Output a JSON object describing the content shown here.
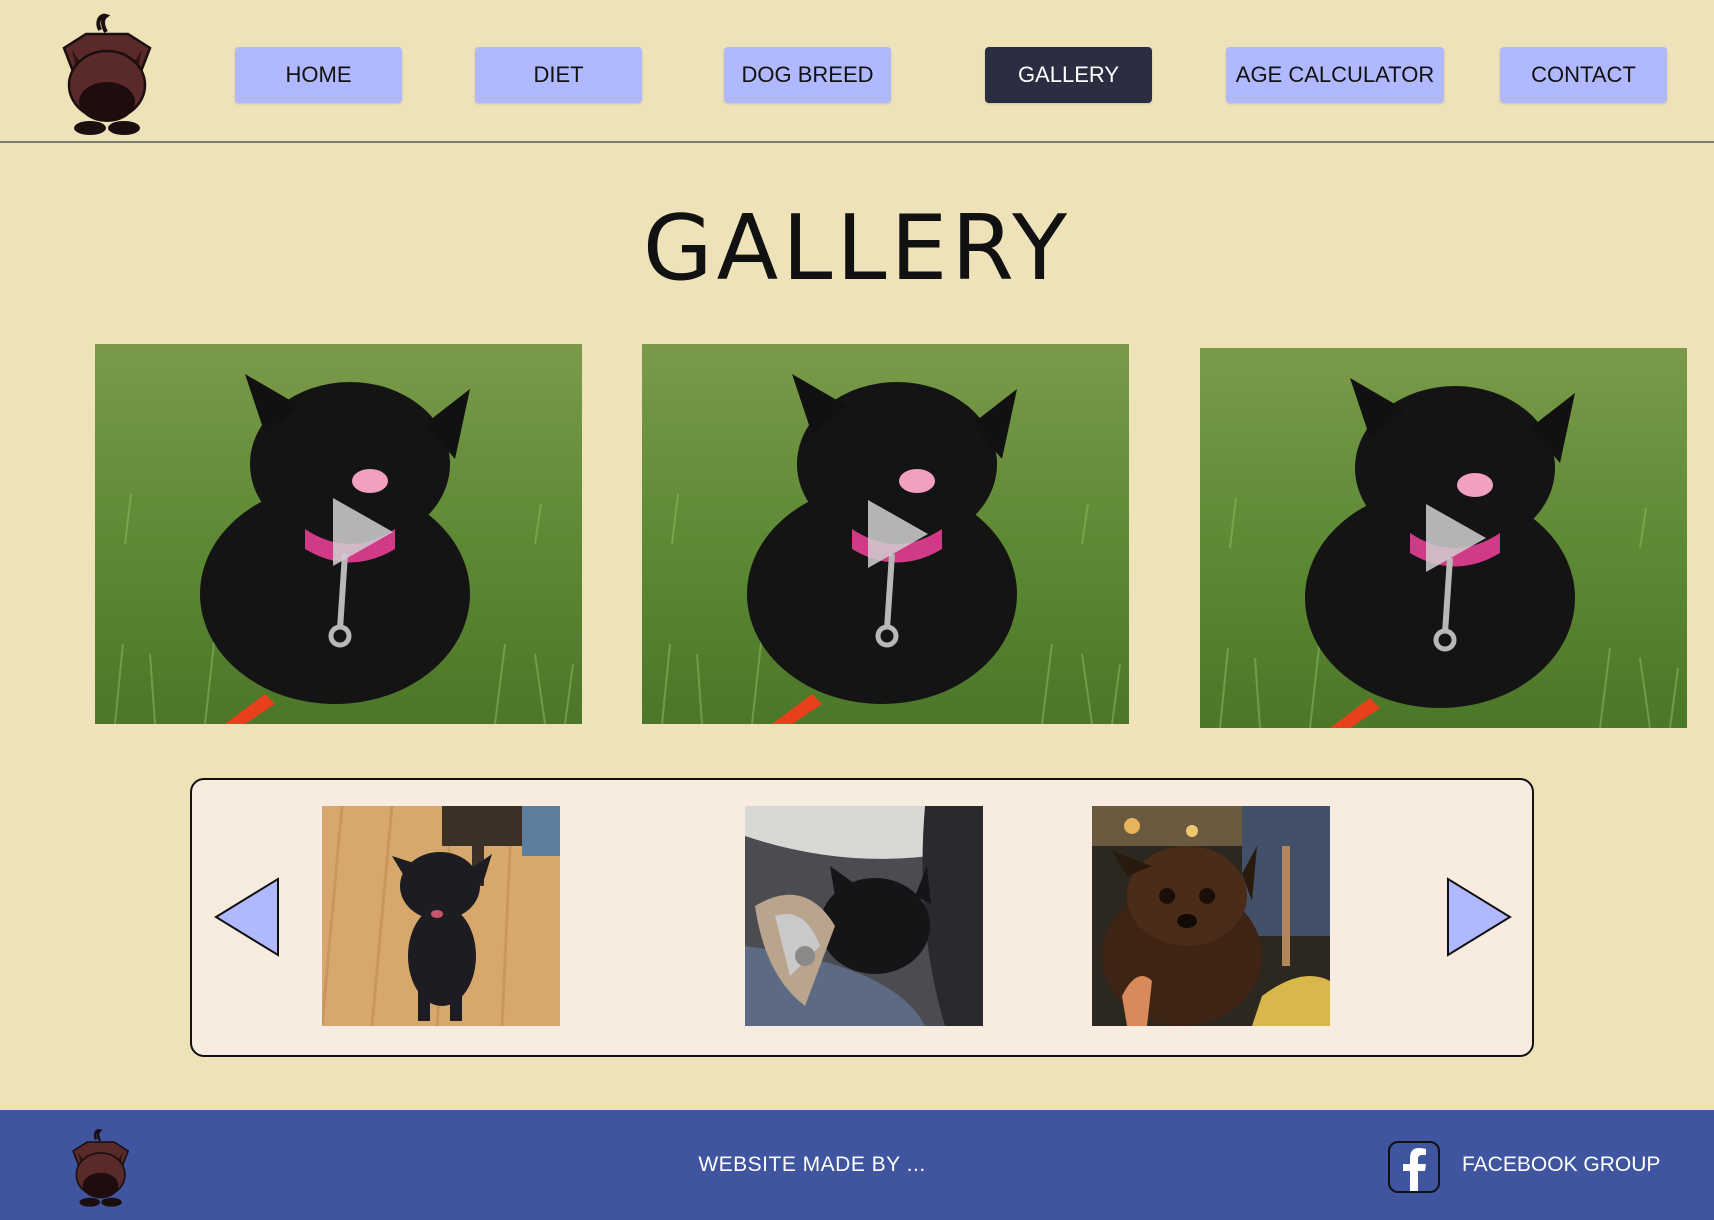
{
  "nav": {
    "items": [
      {
        "label": "HOME",
        "active": false
      },
      {
        "label": "DIET",
        "active": false
      },
      {
        "label": "DOG BREED",
        "active": false
      },
      {
        "label": "GALLERY",
        "active": true
      },
      {
        "label": "AGE CALCULATOR",
        "active": false
      },
      {
        "label": "CONTACT",
        "active": false
      }
    ]
  },
  "main": {
    "title": "GALLERY",
    "videos": [
      {
        "icon": "play-icon"
      },
      {
        "icon": "play-icon"
      },
      {
        "icon": "play-icon"
      }
    ],
    "carousel": {
      "prev_icon": "triangle-left-icon",
      "next_icon": "triangle-right-icon",
      "photo_count": 3
    }
  },
  "footer": {
    "credit": "WEBSITE MADE BY ...",
    "facebook_label": "FACEBOOK GROUP",
    "facebook_icon": "facebook-icon"
  },
  "colors": {
    "page_bg": "#eee2b9",
    "nav_button": "#b0b8ff",
    "nav_active": "#2b2e40",
    "carousel_bg": "#f8ebe0",
    "footer_bg": "#3f55a0",
    "logo": "#5a2a2a"
  }
}
